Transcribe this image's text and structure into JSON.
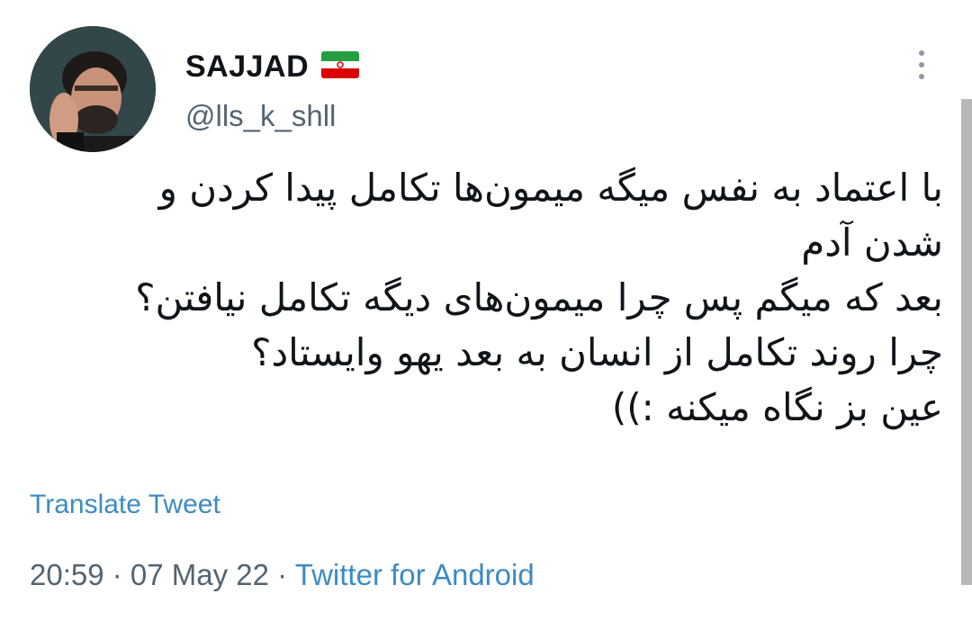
{
  "author": {
    "display_name": "SAJJAD",
    "handle": "@lls_k_shll",
    "flag_icon": "iran-flag-icon",
    "avatar": "profile-avatar"
  },
  "tweet": {
    "lines": [
      "با اعتماد به نفس میگه میمون‌ها تکامل پیدا کردن و",
      "شدن آدم",
      "بعد که میگم پس چرا میمون‌های دیگه تکامل نیافتن؟",
      "چرا روند تکامل از انسان به بعد یهو وایستاد؟",
      "عین بز نگاه میکنه :))"
    ]
  },
  "translate_label": "Translate Tweet",
  "meta": {
    "time": "20:59",
    "separator": " · ",
    "date": "07 May 22",
    "source": "Twitter for Android"
  },
  "colors": {
    "link": "#3c8bc4",
    "secondary_text": "#536471",
    "primary_text": "#0f1419",
    "flag_green": "#239f40",
    "flag_red": "#da0000"
  }
}
